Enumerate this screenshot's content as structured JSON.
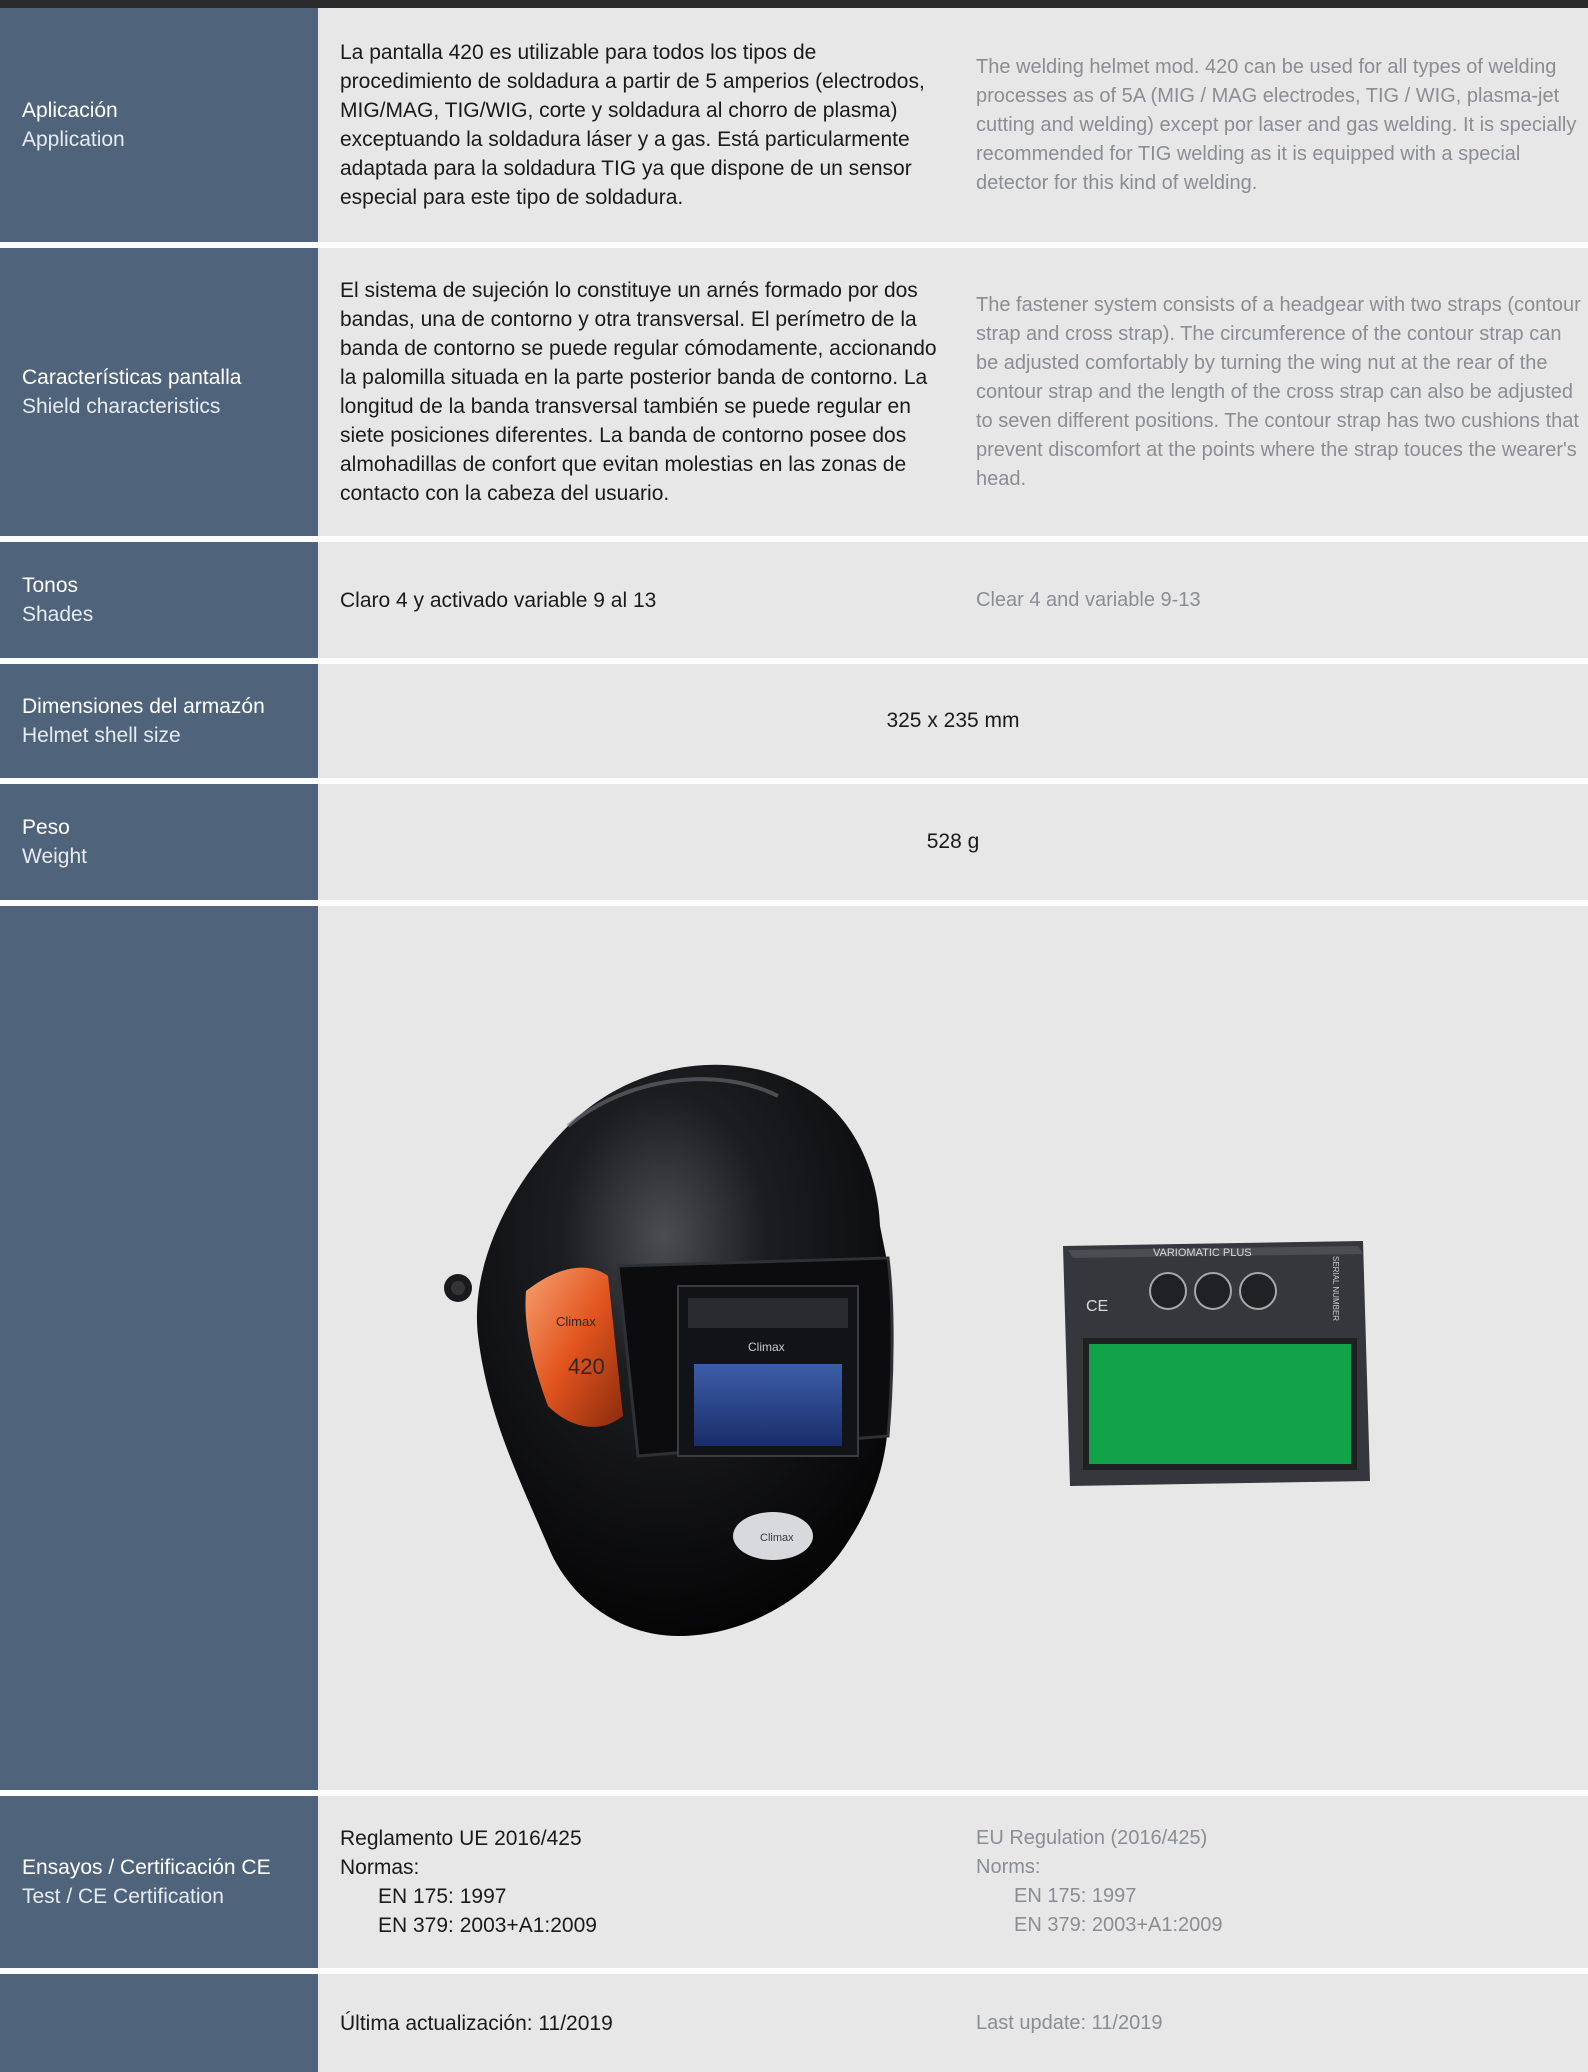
{
  "application": {
    "label_es": "Aplicación",
    "label_en": "Application",
    "text_es": "La pantalla 420 es utilizable para todos los tipos de procedimiento de soldadura a partir de 5 amperios (electrodos, MIG/MAG, TIG/WIG, corte y soldadura al chorro de plasma) exceptuando la soldadura láser y a gas. Está particularmente adaptada para la soldadura TIG ya que dispone de un sensor especial para este tipo de soldadura.",
    "text_en": "The welding helmet mod. 420 can be used for all types of welding processes as of 5A (MIG / MAG electrodes, TIG / WIG, plasma-jet cutting and welding) except por laser and gas welding. It is specially recommended for TIG welding as it is equipped with a special detector for this kind of welding."
  },
  "shield": {
    "label_es": "Características pantalla",
    "label_en": "Shield characteristics",
    "text_es": "El sistema de sujeción lo constituye un arnés formado por dos bandas, una de contorno y otra transversal. El perímetro de la banda de contorno se puede regular cómodamente, accionando la palomilla situada en la parte posterior banda de contorno. La longitud de la banda transversal también se puede regular en siete posiciones diferentes. La banda de contorno posee dos almohadillas de confort que evitan molestias en las zonas de contacto con la cabeza del usuario.",
    "text_en": "The fastener system consists of a headgear with two straps (contour strap and cross strap). The circumference of the contour strap can be adjusted comfortably by turning the wing nut at the rear of the contour strap and the length of the cross strap can also be adjusted to seven different positions. The contour strap has two cushions that prevent discomfort at the points where the strap touces the wearer's head."
  },
  "shades": {
    "label_es": "Tonos",
    "label_en": "Shades",
    "text_es": "Claro 4 y activado variable 9 al 13",
    "text_en": "Clear 4 and variable 9-13"
  },
  "size": {
    "label_es": "Dimensiones del armazón",
    "label_en": "Helmet shell size",
    "value": "325 x 235 mm"
  },
  "weight": {
    "label_es": "Peso",
    "label_en": "Weight",
    "value": "528 g"
  },
  "images": {
    "helmet": {
      "brand_side": "Climax",
      "model": "420",
      "brand_visor": "Climax",
      "brand_chin": "Climax"
    },
    "filter": {
      "title": "VARIOMATIC PLUS",
      "side_text": "SERIAL NUMBER",
      "ce_mark": "CE"
    }
  },
  "certification": {
    "label_es": "Ensayos / Certificación CE",
    "label_en": "Test / CE Certification",
    "es_line1": "Reglamento UE 2016/425",
    "es_line2": "Normas:",
    "es_line3": "EN 175: 1997",
    "es_line4": "EN 379: 2003+A1:2009",
    "en_line1": "EU Regulation (2016/425)",
    "en_line2": "Norms:",
    "en_line3": "EN 175: 1997",
    "en_line4": "EN 379: 2003+A1:2009"
  },
  "update": {
    "text_es": "Última actualización: 11/2019",
    "text_en": "Last update: 11/2019"
  }
}
